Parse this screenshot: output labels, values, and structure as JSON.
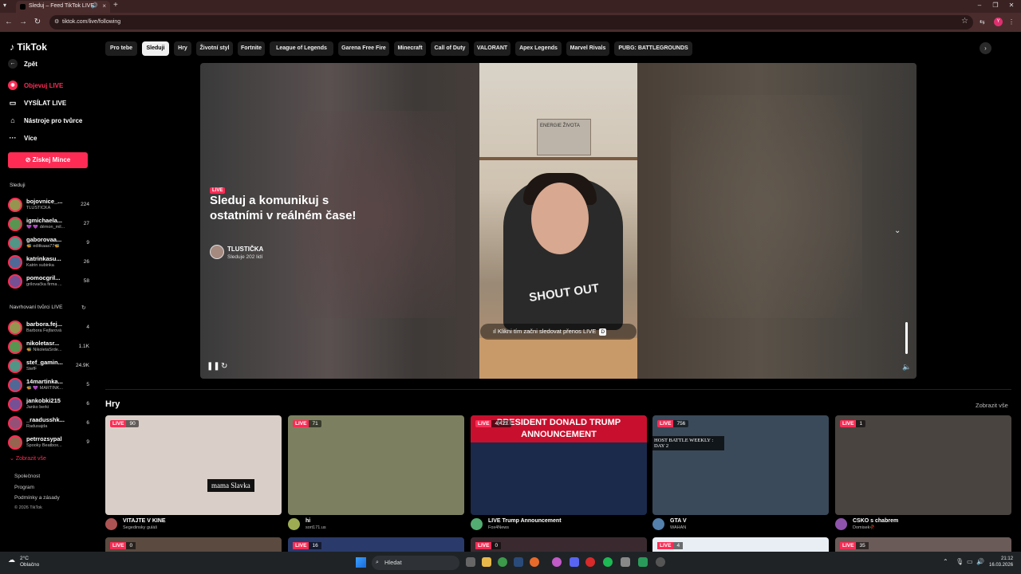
{
  "browser": {
    "tab_title": "Sleduj – Feed TikTok LIVE",
    "url": "tiktok.com/live/following",
    "profile_initial": "Y"
  },
  "sidebar": {
    "logo": "TikTok",
    "back": "Zpět",
    "nav": [
      {
        "label": "Objevuj LIVE",
        "icon": "live-discover-icon"
      },
      {
        "label": "VYSÍLAT LIVE",
        "icon": "camera-icon"
      },
      {
        "label": "Nástroje pro tvůrce",
        "icon": "home-tools-icon"
      },
      {
        "label": "Více",
        "icon": "more-dots-icon"
      }
    ],
    "coins_button": "Získej Mince",
    "following_heading": "Sleduji",
    "following": [
      {
        "name": "bojovnice_...",
        "sub": "TLUSTIČKA",
        "count": "224"
      },
      {
        "name": "igmichaela...",
        "sub": "💜 💜 démon_mil...",
        "count": "27"
      },
      {
        "name": "gaborovaa...",
        "sub": "🐝 editkaaa77🐝",
        "count": "9"
      },
      {
        "name": "katrinkasu...",
        "sub": "Katrin subinka",
        "count": "26"
      },
      {
        "name": "pomocgril...",
        "sub": "grilovačka firma ...",
        "count": "58"
      }
    ],
    "suggested_heading": "Navrhovaní tvůrci LIVE",
    "suggested": [
      {
        "name": "barbora.fej...",
        "sub": "Barbora Fejfarová",
        "count": "4"
      },
      {
        "name": "nikoletasr...",
        "sub": "🐝 NikoletaSrde...",
        "count": "1.1K"
      },
      {
        "name": "stef_gamin...",
        "sub": "StefF",
        "count": "24.9K"
      },
      {
        "name": "14martinka...",
        "sub": "🐝 💜 MARTINK...",
        "count": "5"
      },
      {
        "name": "jankobki215",
        "sub": "Janko berki",
        "count": "6"
      },
      {
        "name": "_raadusshk...",
        "sub": "Radusajda",
        "count": "6"
      },
      {
        "name": "petrrozsypal",
        "sub": "Spooky Beatbox...",
        "count": "9"
      }
    ],
    "show_all": "Zobrazit vše",
    "footer": [
      "Společnost",
      "Program",
      "Podmínky a zásady",
      "© 2026 TikTok"
    ]
  },
  "chips": [
    {
      "label": "Pro tebe",
      "active": false
    },
    {
      "label": "Sleduji",
      "active": true
    },
    {
      "label": "Hry",
      "active": false
    },
    {
      "label": "Životní styl",
      "active": false
    },
    {
      "label": "Fortnite",
      "active": false
    },
    {
      "label": "League of Legends",
      "active": false
    },
    {
      "label": "Garena Free Fire",
      "active": false
    },
    {
      "label": "Minecraft",
      "active": false
    },
    {
      "label": "Call of Duty",
      "active": false
    },
    {
      "label": "VALORANT",
      "active": false
    },
    {
      "label": "Apex Legends",
      "active": false
    },
    {
      "label": "Marvel Rivals",
      "active": false
    },
    {
      "label": "PUBG: BATTLEGROUNDS",
      "active": false
    }
  ],
  "hero": {
    "live_label": "LIVE",
    "title": "Sleduj a komunikuj s ostatními v reálném čase!",
    "host_name": "TLUSTIČKA",
    "host_sub": "Sleduje 202 lidí",
    "cta": "Klikni tím začni sledovat přenos LIVE",
    "cta_key": "D",
    "poster_text": "ENERGIE ŽIVOTA",
    "shirt_text": "SHOUT OUT"
  },
  "games": {
    "title": "Hry",
    "see_all": "Zobrazit vše",
    "cards": [
      {
        "live": "LIVE",
        "viewers": "90",
        "title": "VITAJTE V KINE",
        "sub": "Segedinsky guláš",
        "color": "#d9cfc8",
        "overlay": "mama Slavka"
      },
      {
        "live": "LIVE",
        "viewers": "71",
        "title": "hi",
        "sub": "sort171.us",
        "color": "#7c8060"
      },
      {
        "live": "LIVE",
        "viewers": "4,422",
        "title": "LIVE Trump Announcement",
        "sub": "Fox4News",
        "color": "#1b2a4a",
        "overlay": "PRESIDENT DONALD TRUMP ANNOUNCEMENT"
      },
      {
        "live": "LIVE",
        "viewers": "756",
        "title": "GTA V",
        "sub": "WAHAN",
        "color": "#3a4a5a",
        "overlay": "HOST BATTLE WEEKLY : DAY 2"
      },
      {
        "live": "LIVE",
        "viewers": "1",
        "title": "CSKO s chabrem",
        "sub": "Domisek🥀",
        "color": "#4a4440"
      }
    ],
    "row2": [
      {
        "live": "LIVE",
        "viewers": "0"
      },
      {
        "live": "LIVE",
        "viewers": "16"
      },
      {
        "live": "LIVE",
        "viewers": "0"
      },
      {
        "live": "LIVE",
        "viewers": "4"
      },
      {
        "live": "LIVE",
        "viewers": "35"
      }
    ]
  },
  "taskbar": {
    "weather_temp": "2°C",
    "weather_text": "Oblačno",
    "search": "Hledat",
    "time": "21:12",
    "date": "16.03.2026"
  }
}
